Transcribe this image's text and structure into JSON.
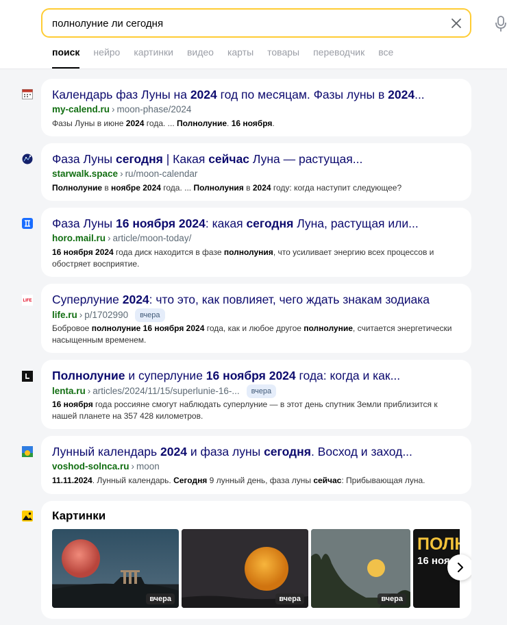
{
  "search": {
    "query": "полнолуние ли сегодня"
  },
  "tabs": [
    {
      "label": "поиск",
      "active": true
    },
    {
      "label": "нейро"
    },
    {
      "label": "картинки"
    },
    {
      "label": "видео"
    },
    {
      "label": "карты"
    },
    {
      "label": "товары"
    },
    {
      "label": "переводчик"
    },
    {
      "label": "все"
    }
  ],
  "results": [
    {
      "title_parts": [
        [
          "Календарь фаз Луны на ",
          0
        ],
        [
          "2024",
          1
        ],
        [
          " год по месяцам. Фазы луны в ",
          0
        ],
        [
          "2024",
          1
        ],
        [
          "...",
          0
        ]
      ],
      "domain": "my-calend.ru",
      "path": "moon-phase/2024",
      "badge": "",
      "snippet_parts": [
        [
          "Фазы Луны в июне ",
          0
        ],
        [
          "2024",
          1
        ],
        [
          " года. ... ",
          0
        ],
        [
          "Полнолуние",
          1
        ],
        [
          ". ",
          0
        ],
        [
          "16 ноября",
          1
        ],
        [
          ".",
          0
        ]
      ],
      "favicon": "calendar-icon"
    },
    {
      "title_parts": [
        [
          "Фаза Луны ",
          0
        ],
        [
          "сегодня",
          1
        ],
        [
          " | Какая ",
          0
        ],
        [
          "сейчас",
          1
        ],
        [
          " Луна — растущая...",
          0
        ]
      ],
      "domain": "starwalk.space",
      "path": "ru/moon-calendar",
      "badge": "",
      "snippet_parts": [
        [
          "Полнолуние",
          1
        ],
        [
          " в ",
          0
        ],
        [
          "ноябре 2024",
          1
        ],
        [
          " года. ... ",
          0
        ],
        [
          "Полнолуния",
          1
        ],
        [
          " в ",
          0
        ],
        [
          "2024",
          1
        ],
        [
          " году: когда наступит следующее?",
          0
        ]
      ],
      "favicon": "starwalk-icon"
    },
    {
      "title_parts": [
        [
          "Фаза Луны ",
          0
        ],
        [
          "16 ноября 2024",
          1
        ],
        [
          ": какая ",
          0
        ],
        [
          "сегодня",
          1
        ],
        [
          " Луна, растущая или...",
          0
        ]
      ],
      "domain": "horo.mail.ru",
      "path": "article/moon-today/",
      "badge": "",
      "snippet_parts": [
        [
          "16 ноября 2024",
          1
        ],
        [
          " года диск находится в фазе ",
          0
        ],
        [
          "полнолуния",
          1
        ],
        [
          ", что усиливает энергию всех процессов и обостряет восприятие.",
          0
        ]
      ],
      "favicon": "gemini-icon"
    },
    {
      "title_parts": [
        [
          "Суперлуние ",
          0
        ],
        [
          "2024",
          1
        ],
        [
          ": что это, как повлияет, чего ждать знакам зодиака",
          0
        ]
      ],
      "domain": "life.ru",
      "path": "p/1702990",
      "badge": "вчера",
      "snippet_parts": [
        [
          "Бобровое ",
          0
        ],
        [
          "полнолуние 16 ноября 2024",
          1
        ],
        [
          " года, как и любое другое ",
          0
        ],
        [
          "полнолуние",
          1
        ],
        [
          ", считается энергетически насыщенным временем.",
          0
        ]
      ],
      "favicon": "life-logo-icon"
    },
    {
      "title_parts": [
        [
          "Полнолуние",
          1
        ],
        [
          " и суперлуние ",
          0
        ],
        [
          "16 ноября 2024",
          1
        ],
        [
          " года: когда и как...",
          0
        ]
      ],
      "domain": "lenta.ru",
      "path": "articles/2024/11/15/superlunie-16-...",
      "badge": "вчера",
      "snippet_parts": [
        [
          "16 ноября",
          1
        ],
        [
          " года россияне смогут наблюдать суперлуние — в этот день спутник Земли приблизится к нашей планете на 357 428 километров.",
          0
        ]
      ],
      "favicon": "lenta-logo-icon"
    },
    {
      "title_parts": [
        [
          "Лунный календарь ",
          0
        ],
        [
          "2024",
          1
        ],
        [
          " и фаза луны ",
          0
        ],
        [
          "сегодня",
          1
        ],
        [
          ". Восход и заход...",
          0
        ]
      ],
      "domain": "voshod-solnca.ru",
      "path": "moon",
      "badge": "",
      "snippet_parts": [
        [
          "11.11.2024",
          1
        ],
        [
          ". Лунный календарь. ",
          0
        ],
        [
          "Сегодня",
          1
        ],
        [
          " 9 лунный день, фаза луны ",
          0
        ],
        [
          "сейчас",
          1
        ],
        [
          ": Прибывающая луна.",
          0
        ]
      ],
      "favicon": "sunrise-icon"
    }
  ],
  "images": {
    "title": "Картинки",
    "thumbs": [
      {
        "badge": "вчера",
        "depicts": "red-moon-over-ruins"
      },
      {
        "badge": "вчера",
        "depicts": "orange-full-moon"
      },
      {
        "badge": "вчера",
        "depicts": "yellow-moon-over-trees"
      },
      {
        "badge": "",
        "depicts": "text-banner",
        "text_line1": "ПОЛН",
        "text_line2": "16 ноя"
      }
    ]
  },
  "colors": {
    "title_link": "#0c0a6e",
    "domain_green": "#116e11",
    "search_border": "#ffcc33"
  }
}
